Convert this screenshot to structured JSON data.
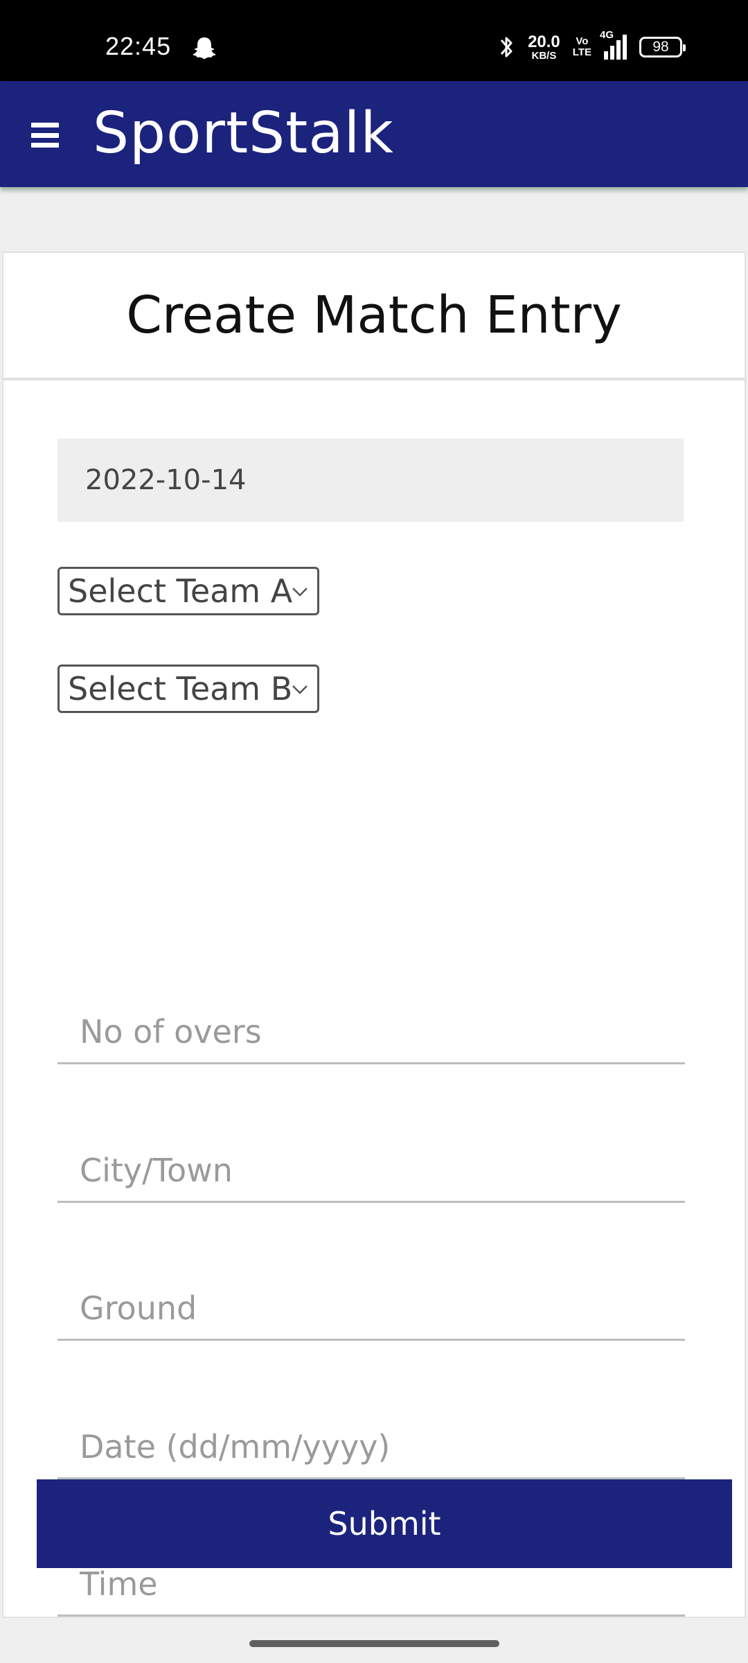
{
  "status_bar": {
    "time": "22:45",
    "net_speed_value": "20.0",
    "net_speed_unit": "KB/S",
    "volte_top": "Vo",
    "volte_bottom": "LTE",
    "network_type": "4G",
    "battery": "98",
    "icons": [
      "snapchat-ghost-icon",
      "bluetooth-icon",
      "signal-icon",
      "battery-icon"
    ]
  },
  "appbar": {
    "title": "SportStalk",
    "menu_icon": "hamburger-menu-icon",
    "background_color": "#1b237d"
  },
  "form": {
    "heading": "Create Match Entry",
    "date_display": "2022-10-14",
    "team_a": {
      "selected": "Select Team A"
    },
    "team_b": {
      "selected": "Select Team B"
    },
    "fields": {
      "overs_placeholder": "No of overs",
      "city_placeholder": "City/Town",
      "ground_placeholder": "Ground",
      "date_placeholder": "Date (dd/mm/yyyy)",
      "time_placeholder": "Time"
    },
    "submit_label": "Submit"
  }
}
